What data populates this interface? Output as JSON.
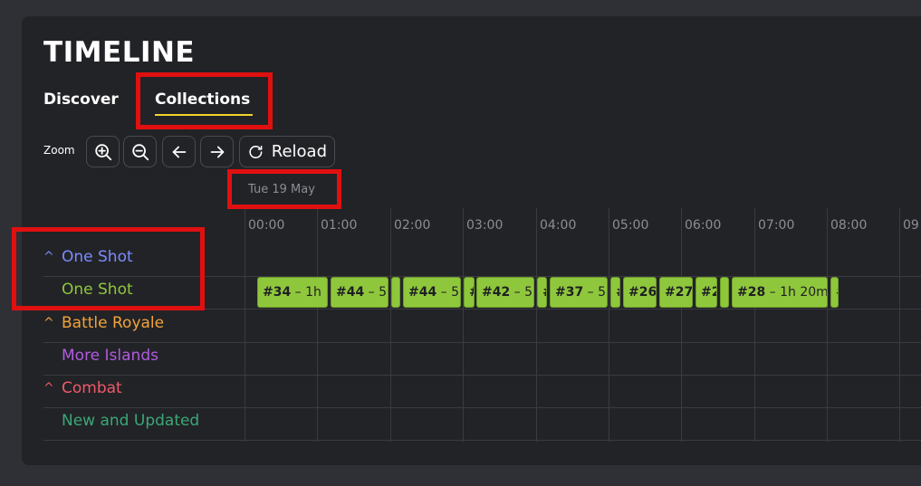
{
  "page": {
    "title": "TIMELINE"
  },
  "tabs": [
    {
      "label": "Discover"
    },
    {
      "label": "Collections"
    }
  ],
  "toolbar": {
    "zoom_label": "Zoom",
    "reload_label": "Reload"
  },
  "timeline": {
    "date": "Tue 19 May",
    "hours": [
      "00:00",
      "01:00",
      "02:00",
      "03:00",
      "04:00",
      "05:00",
      "06:00",
      "07:00",
      "08:00",
      "09"
    ]
  },
  "rows": [
    {
      "label": "One Shot",
      "color": "#7b8cff",
      "caret": "^"
    },
    {
      "label": "One Shot",
      "color": "#8fc73c",
      "caret": ""
    },
    {
      "label": "Battle Royale",
      "color": "#f2a43a",
      "caret": "^"
    },
    {
      "label": "More Islands",
      "color": "#b05be0",
      "caret": ""
    },
    {
      "label": "Combat",
      "color": "#ef5a6a",
      "caret": "^"
    },
    {
      "label": "New and Updated",
      "color": "#3aa877",
      "caret": ""
    }
  ],
  "blocks": [
    {
      "id": "#34",
      "duration": " – 1h"
    },
    {
      "id": "#44",
      "duration": " – 5"
    },
    {
      "id": "",
      "duration": ""
    },
    {
      "id": "#44",
      "duration": " – 5"
    },
    {
      "id": "#",
      "duration": ""
    },
    {
      "id": "#42",
      "duration": " – 5"
    },
    {
      "id": "#",
      "duration": ""
    },
    {
      "id": "#37",
      "duration": " – 5"
    },
    {
      "id": "#",
      "duration": ""
    },
    {
      "id": "#26",
      "duration": ""
    },
    {
      "id": "#27",
      "duration": ""
    },
    {
      "id": "#2",
      "duration": ""
    },
    {
      "id": "",
      "duration": ""
    },
    {
      "id": "#28",
      "duration": " – 1h 20m"
    },
    {
      "id": "#",
      "duration": ""
    }
  ]
}
